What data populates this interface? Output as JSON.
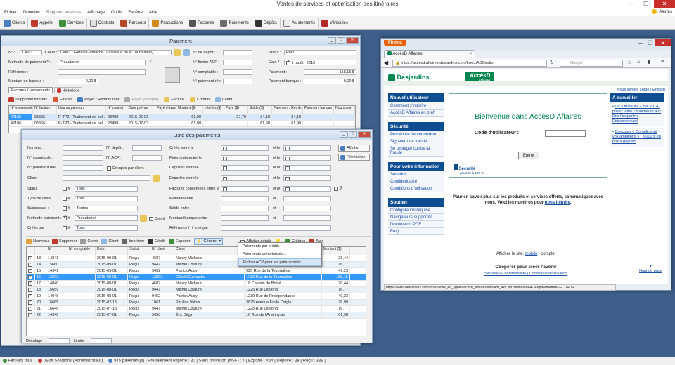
{
  "app": {
    "title": "Ventes de services et optimisation des itinéraires",
    "alerts": "Alertes"
  },
  "menu": [
    "Fichier",
    "Données",
    "Rapports externes",
    "Affichage",
    "Outils",
    "Fenêtre",
    "Aide"
  ],
  "toolbar": [
    "Clients",
    "Appels",
    "Services",
    "Contrats",
    "Parcours",
    "Productions",
    "Factures",
    "Paiements",
    "Dépôts",
    "Ajustements",
    "Véhicules"
  ],
  "status": {
    "user1": "Ferti-sol plus",
    "user2": "uSoft Solutions (Administrateur)",
    "summary": "845 paiement(s) | Prépaiement exporté : 20 | Sans provision (NSF) : 4 | Exporté : 464 | Déposé : 28 | Reçu : 329 |"
  },
  "paiement": {
    "title": "Paiement",
    "labels": {
      "no": "N° :",
      "client": "Client * :",
      "depot": "N° de dépôt :",
      "statut": "Statut :",
      "methode": "Méthode de paiement * :",
      "acp": "N° fichier ACP :",
      "date": "Date * :",
      "reference": "Référence :",
      "comptable": "N° comptable :",
      "paiement": "Paiement :",
      "montant_banque": "Montant en banque :",
      "paiement_reel": "N° paiement réel :",
      "paiement_banque": "Paiement banque :"
    },
    "values": {
      "no": "13693",
      "client": "13803 - Gérald Gamache  (1239 Rue de la Tourmaline)",
      "statut": "Reçu",
      "methode": "Préautorisé",
      "date_day": "1",
      "date_month": "août",
      "date_year": "2015",
      "paiement": "158,15 $",
      "montant_banque": "0,00 $",
      "paiement_banque": "0,00 $"
    },
    "tabs": [
      "Factures / Versements",
      "Historique"
    ],
    "actions": [
      "Supprimer intérêts",
      "Effacer",
      "Payer / Rembourser",
      "Payer (banque)",
      "Facture",
      "Contrat",
      "Client"
    ],
    "columns": [
      "N° versement",
      "N° facture",
      "Lieu au parcours",
      "N° contrat",
      "Date prévue",
      "Payé d'avance",
      "Montant ($)",
      "Intérêts ($)",
      "Payé ($)",
      "Solde ($)",
      "Paiement / Remb. ($)",
      "Paiement banque ($)",
      "Nou solde"
    ],
    "rows": [
      [
        "42105",
        "05555",
        "P-TP2 - Traitement de pel...",
        "23498",
        "2015-06-03",
        "",
        "61,98",
        "",
        "27,79",
        "34,19",
        "34,19",
        "",
        ""
      ],
      [
        "42106",
        "05556",
        "P-TP3 - Traitement de pel...",
        "23498",
        "2015-07-03",
        "",
        "61,98",
        "",
        "",
        "61,98",
        "61,98",
        "",
        ""
      ]
    ]
  },
  "liste": {
    "title": "Liste des paiements",
    "labels": {
      "numero": "Numéro :",
      "depot": "N° dépôt :",
      "comptable": "N° comptable :",
      "acp": "N° ACP :",
      "paiement_reel": "N° paiement réel :",
      "groupes": "Groupés par client",
      "client": "Client :",
      "statut": "Statut :",
      "type_client": "Type de client :",
      "succursale": "Succursale :",
      "methode": "Méthode paiement :",
      "credit": "Crédit",
      "crees": "Créés par :",
      "crees_entre": "Créés entre le",
      "paiements_entre": "Paiements entre le",
      "deposes_entre": "Déposés entre le",
      "exportes_entre": "Exportés entre le",
      "factures_entre": "Factures concernées entre le",
      "montant_entre": "Montant entre",
      "solde_entre": "Solde entre",
      "montant_banque_entre": "Montant banque entre",
      "reference": "Référence / n° chèque :",
      "et": "et le",
      "et2": "et"
    },
    "values": {
      "statut": "Tous",
      "type_client": "Tous",
      "succursale": "Toutes",
      "methode": "Préautorisé",
      "crees": "Tous",
      "sigma": "Σ",
      "hash": "#"
    },
    "buttons": {
      "afficher": "Afficher",
      "reinit": "Réinitialiser"
    },
    "actions": [
      "Nouveau",
      "Supprimer",
      "Ouvrir",
      "Client",
      "Imprimer",
      "Dépôt",
      "Exporter",
      "Générer",
      "Afficher détails",
      "Critères",
      "Aide"
    ],
    "generer_menu": [
      "Paiements par crédit...",
      "Paiements préautorisés...",
      "Fichier ACP pour les préautorisés..."
    ],
    "columns": [
      "",
      "N°",
      "N° comptable",
      "Date",
      "Statut",
      "N° client",
      "Client",
      "",
      "Montant ($)"
    ],
    "rows": [
      [
        "13",
        "14841",
        "",
        "2015-09-01",
        "Reçu",
        "4687",
        "Nancy Michaud",
        "14 Rue Gendron",
        "26,44"
      ],
      [
        "14",
        "15660",
        "",
        "2015-09-01",
        "Reçu",
        "9447",
        "Michel Couture",
        "1239 Rue de la Tourmaline",
        "16,77"
      ],
      [
        "15",
        "14949",
        "",
        "2015-09-01",
        "Reçu",
        "9452",
        "Patrick Audy",
        "925 Rue de la Tourmaline",
        "49,23"
      ],
      [
        "16",
        "13693",
        "",
        "2015-08-01",
        "Reçu",
        "13803",
        "Gérald Gamache",
        "1239 Rue de la Tourmaline",
        "158,15"
      ],
      [
        "17",
        "14840",
        "",
        "2015-08-01",
        "Reçu",
        "4687",
        "Nancy Michaud",
        "18 Chemin du Boisé",
        "26,44"
      ],
      [
        "18",
        "15659",
        "",
        "2015-08-01",
        "Reçu",
        "9447",
        "Michel Couture",
        "1225 Rue Leblond",
        "16,77"
      ],
      [
        "19",
        "14948",
        "",
        "2015-08-01",
        "Reçu",
        "9452",
        "Patrick Audy",
        "1239 Rue de l'Indépendance",
        "49,23"
      ],
      [
        "20",
        "16665",
        "",
        "2015-07-15",
        "Reçu",
        "1861",
        "Pauline Valois",
        "3625 Avenue Émile Daigle",
        "26,99"
      ],
      [
        "21",
        "16646",
        "",
        "2015-07-15",
        "Reçu",
        "9447",
        "Michel Couture",
        "1225 Rue Leblond",
        "16,77"
      ],
      [
        "22",
        "14946",
        "",
        "2015-07-01",
        "Reçu",
        "9450",
        "Éric Bégin",
        "16 Rue de l'Améthyste",
        "61,98"
      ]
    ],
    "footer": {
      "decalage": "Décalage :",
      "limite": "Limite :"
    }
  },
  "browser": {
    "firefox": "Firefox",
    "tab": "AccèsD Affaires",
    "url": "https://accesd.affaires.desjardins.com/lisecuADGestio",
    "search": "Google",
    "brand": "Desjardins",
    "accesd": "AccèsD",
    "affaires": "Affaires",
    "toplinks": "Nous joindre | Aide | English",
    "welcome": "Bienvenue dans AccèsD Affaires",
    "code_label": "Code d'utilisateur :",
    "enter": "Entrer",
    "securite": "Sécurité",
    "garantie": "garantie à 100 %",
    "info1": "Pour en savoir plus sur les produits et services offerts, communiquez avec nous. Voici les numéros pour",
    "info_link": "nous joindre",
    "side": [
      {
        "h": "Nouvel utilisateur",
        "items": [
          "Comment s'inscrire",
          "AccèsD Affaires en bref"
        ]
      },
      {
        "h": "Sécurité",
        "items": [
          "Procédure de connexion",
          "Signaler une fraude",
          "Se protéger contre la fraude"
        ]
      },
      {
        "h": "Pour votre information",
        "items": [
          "Sécurité",
          "Confidentialité",
          "Conditions d'utilisation"
        ]
      },
      {
        "h": "Soutien",
        "items": [
          "Configuration requise",
          "Navigateurs supportés",
          "Documents PDF",
          "FAQ"
        ]
      }
    ],
    "surveiller": "À surveiller",
    "surv1": "Du 3 mars au 2 mai 2014, posez votre candidature aux Prix Desjardins Entrepreneurs!",
    "surv2": "Concours « Complice de vos ambitions » : 5 000 $ en prix à gagner!",
    "site": "Afficher le site:",
    "mobile": "mobile",
    "complet": "| complet",
    "cooperer": "Coopérer pour créer l'avenir",
    "footer_links": "Sécurité | Confidentialité | Conditions d'utilisation",
    "haut": "Haut de page",
    "statusurl": "https://www.desjardins.com/fr/services_en_ligne/accesd_affaires/info/adr_exit.jsp?domaine=ADA&parametre=SECURITE"
  },
  "colors": {
    "accent": "#3399ff",
    "desjardins": "#00874e",
    "nav": "#0e4d92"
  }
}
